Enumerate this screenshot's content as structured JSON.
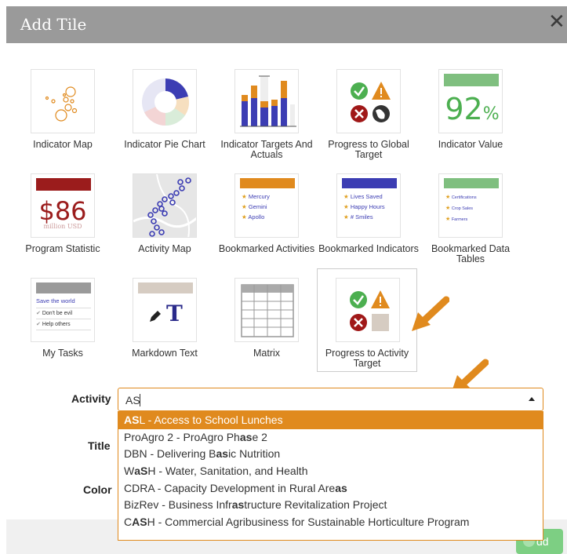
{
  "dialog": {
    "title": "Add Tile",
    "close_glyph": "✕"
  },
  "tiles": [
    {
      "label": "Indicator Map"
    },
    {
      "label": "Indicator Pie Chart"
    },
    {
      "label": "Indicator Targets And Actuals"
    },
    {
      "label": "Progress to Global Target"
    },
    {
      "label": "Indicator Value"
    },
    {
      "label": "Program Statistic"
    },
    {
      "label": "Activity Map"
    },
    {
      "label": "Bookmarked Activities"
    },
    {
      "label": "Bookmarked Indicators"
    },
    {
      "label": "Bookmarked Data Tables"
    },
    {
      "label": "My Tasks"
    },
    {
      "label": "Markdown Text"
    },
    {
      "label": "Matrix"
    },
    {
      "label": "Progress to Activity Target"
    }
  ],
  "thumbs": {
    "indicator_value": {
      "number": "92",
      "unit": "%"
    },
    "program_statistic": {
      "value": "$86",
      "caption": "million USD"
    },
    "bookmarked_activities": [
      "Mercury",
      "Gemini",
      "Apollo"
    ],
    "bookmarked_indicators": [
      "Lives Saved",
      "Happy Hours",
      "# Smiles"
    ],
    "bookmarked_data_tables": [
      "Certifications",
      "Crop Sales",
      "Farmers"
    ],
    "my_tasks": {
      "heading": "Save the world",
      "items": [
        "Don't be evil",
        "Help others"
      ]
    },
    "markdown_glyph": "T"
  },
  "form": {
    "activity_label": "Activity",
    "activity_value": "AS",
    "title_label": "Title",
    "color_label": "Color"
  },
  "dropdown_options": [
    {
      "parts": [
        [
          "b",
          "AS"
        ],
        [
          "n",
          "L - Access to School Lunches"
        ]
      ]
    },
    {
      "parts": [
        [
          "n",
          "ProAgro 2 - ProAgro Ph"
        ],
        [
          "b",
          "as"
        ],
        [
          "n",
          "e 2"
        ]
      ]
    },
    {
      "parts": [
        [
          "n",
          "DBN - Delivering B"
        ],
        [
          "b",
          "as"
        ],
        [
          "n",
          "ic Nutrition"
        ]
      ]
    },
    {
      "parts": [
        [
          "n",
          "W"
        ],
        [
          "b",
          "aS"
        ],
        [
          "n",
          "H - Water, Sanitation, and Health"
        ]
      ]
    },
    {
      "parts": [
        [
          "n",
          "CDRA - Capacity Development in Rural Are"
        ],
        [
          "b",
          "as"
        ]
      ]
    },
    {
      "parts": [
        [
          "n",
          "BizRev - Business Infr"
        ],
        [
          "b",
          "as"
        ],
        [
          "n",
          "tructure Revitalization Project"
        ]
      ]
    },
    {
      "parts": [
        [
          "n",
          "C"
        ],
        [
          "b",
          "AS"
        ],
        [
          "n",
          "H - Commercial Agribusiness for Sustainable Horticulture Program"
        ]
      ]
    }
  ],
  "footer": {
    "add_label": "dd"
  },
  "colors": {
    "accent": "#e08a1e",
    "header": "#9a9a9a",
    "green": "#5cb85c",
    "bar_blue": "#3c3db3",
    "dark_red": "#8b1a1a"
  }
}
